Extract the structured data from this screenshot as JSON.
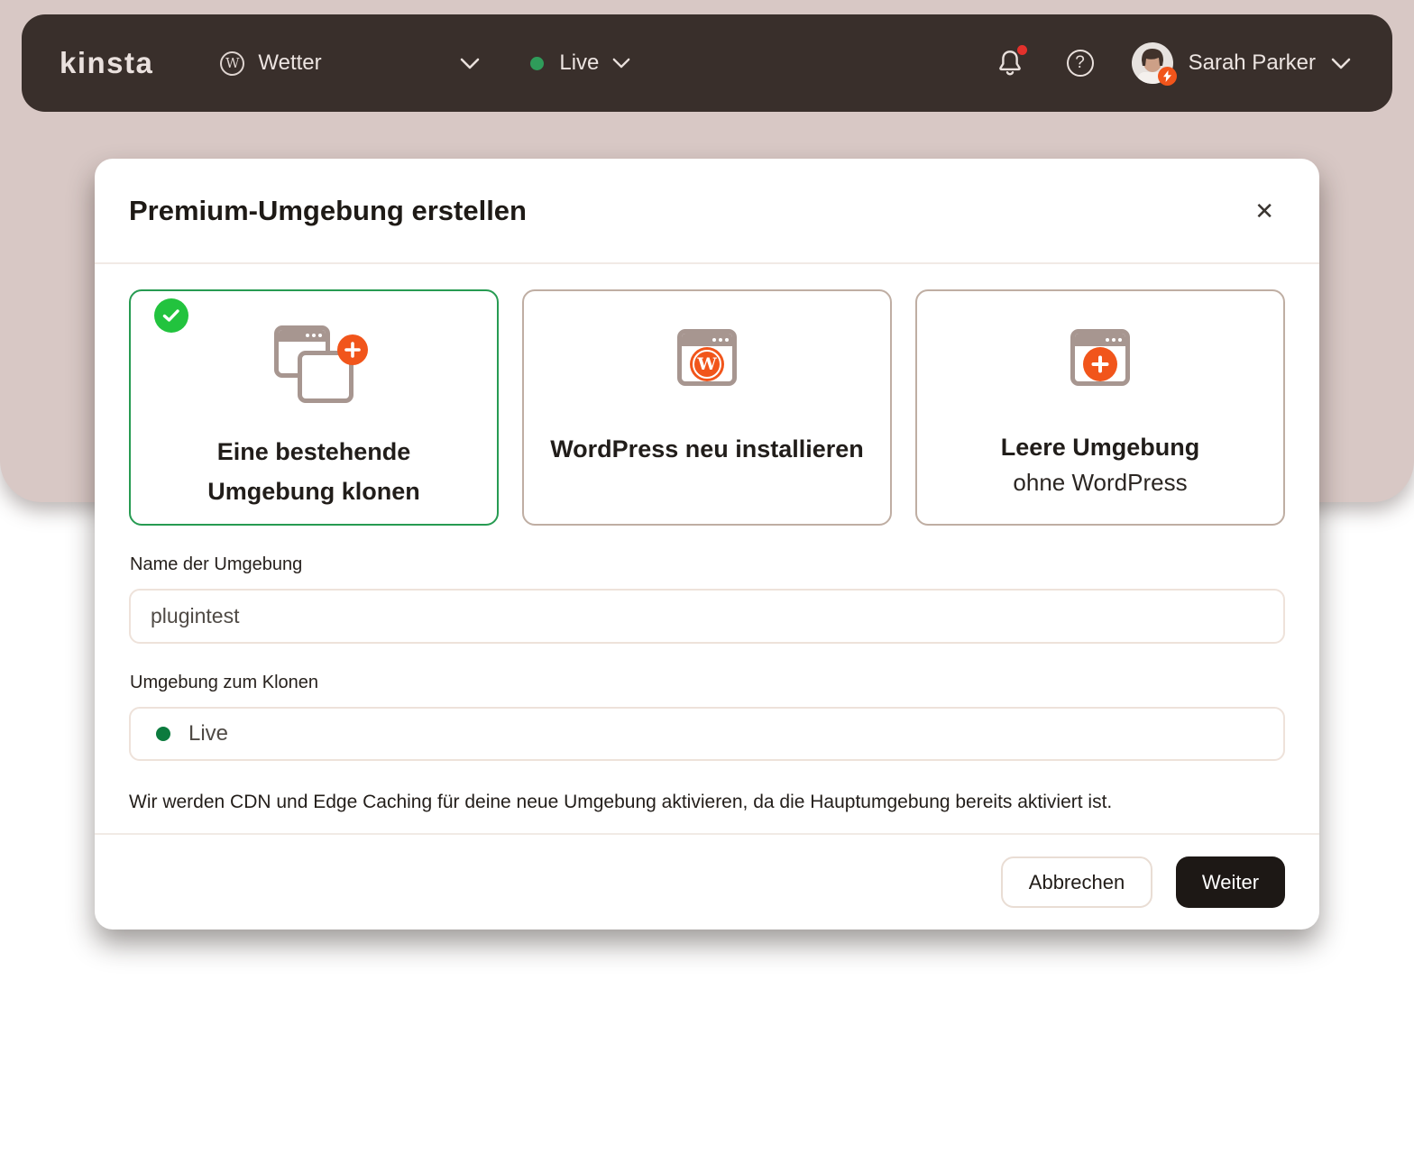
{
  "navbar": {
    "logo": "kinsta",
    "site_selector": {
      "label": "Wetter",
      "wordpress_letter": "W"
    },
    "env_selector": {
      "label": "Live"
    },
    "help_glyph": "?",
    "user": {
      "name": "Sarah Parker"
    }
  },
  "modal": {
    "title": "Premium-Umgebung erstellen",
    "close_glyph": "✕",
    "options": [
      {
        "label": "Eine bestehende Umgebung klonen",
        "selected": true
      },
      {
        "label": "WordPress neu installieren",
        "wordpress_letter": "W"
      },
      {
        "label": "Leere Umgebung",
        "sublabel": "ohne WordPress"
      }
    ],
    "fields": {
      "name_label": "Name der Umgebung",
      "name_value": "plugintest",
      "clone_label": "Umgebung zum Klonen",
      "clone_value": "Live"
    },
    "info": "Wir werden CDN und Edge Caching für deine neue Umgebung aktivieren, da die Hauptumgebung bereits aktiviert ist.",
    "footer": {
      "cancel": "Abbrechen",
      "next": "Weiter"
    }
  },
  "colors": {
    "background_band": "#d8c8c5",
    "navbar_bg": "#392f2b",
    "accent_orange": "#f1551b",
    "selected_green_border": "#279b52",
    "check_badge_green": "#22c33e",
    "live_dot_green": "#0c7b3e",
    "nav_env_dot_green": "#2f9c5a",
    "notification_red": "#e3312c",
    "icon_taupe": "#a79690",
    "primary_button_bg": "#1d1815"
  }
}
